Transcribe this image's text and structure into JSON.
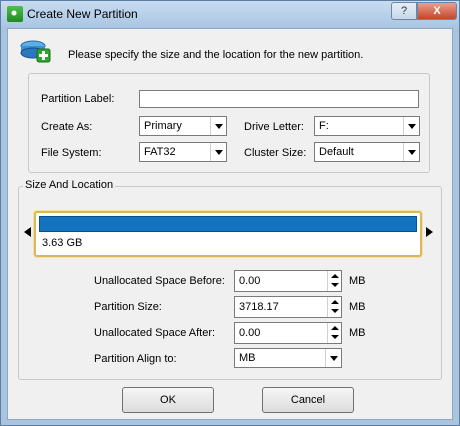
{
  "window": {
    "title": "Create New Partition",
    "help_label": "?",
    "close_label": "X"
  },
  "header": {
    "text": "Please specify the size and the location for the new partition."
  },
  "form": {
    "partition_label_label": "Partition Label:",
    "partition_label_value": "",
    "create_as_label": "Create As:",
    "create_as_value": "Primary",
    "drive_letter_label": "Drive Letter:",
    "drive_letter_value": "F:",
    "file_system_label": "File System:",
    "file_system_value": "FAT32",
    "cluster_size_label": "Cluster Size:",
    "cluster_size_value": "Default"
  },
  "size_location": {
    "legend": "Size And Location",
    "bar_label": "3.63 GB",
    "bar_fill_fraction": 1.0,
    "unallocated_before_label": "Unallocated Space Before:",
    "unallocated_before_value": "0.00",
    "partition_size_label": "Partition Size:",
    "partition_size_value": "3718.17",
    "unallocated_after_label": "Unallocated Space After:",
    "unallocated_after_value": "0.00",
    "align_label": "Partition Align to:",
    "align_value": "MB",
    "unit": "MB"
  },
  "buttons": {
    "ok_label": "OK",
    "cancel_label": "Cancel"
  },
  "colors": {
    "bar_fill": "#1274be",
    "bar_frame": "#d9b85c"
  }
}
